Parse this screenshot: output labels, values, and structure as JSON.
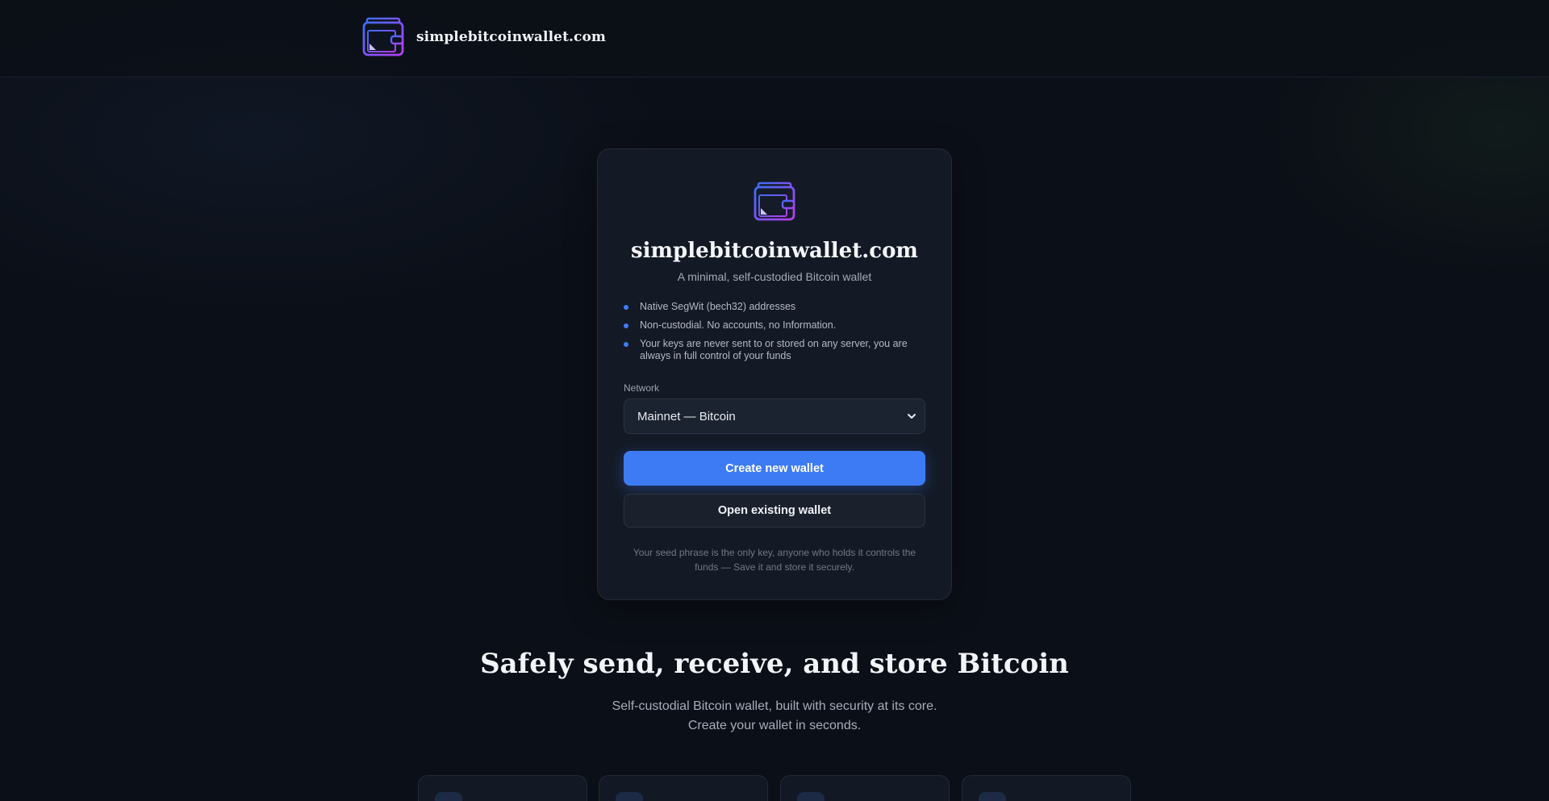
{
  "header": {
    "brand_name": "simplebitcoinwallet.com",
    "logo_icon": "wallet-icon"
  },
  "card": {
    "logo_icon": "wallet-icon",
    "title": "simplebitcoinwallet.com",
    "subtitle": "A minimal, self-custodied Bitcoin wallet",
    "features": [
      "Native SegWit (bech32) addresses",
      "Non-custodial. No accounts, no Information.",
      "Your keys are never sent to or stored on any server, you are always in full control of your funds"
    ],
    "network_label": "Network",
    "network_selected": "Mainnet — Bitcoin",
    "create_button": "Create new wallet",
    "open_button": "Open existing wallet",
    "disclaimer": "Your seed phrase is the only key, anyone who holds it controls the funds — Save it and store it securely."
  },
  "hero": {
    "title": "Safely send, receive, and store Bitcoin",
    "subtitle_line1": "Self-custodial Bitcoin wallet, built with security at its core.",
    "subtitle_line2": "Create your wallet in seconds."
  },
  "colors": {
    "accent": "#3d7bf5",
    "background": "#0b0f17",
    "card": "#141a25",
    "logo_gradient_start": "#3f6df5",
    "logo_gradient_end": "#b63ef2"
  }
}
